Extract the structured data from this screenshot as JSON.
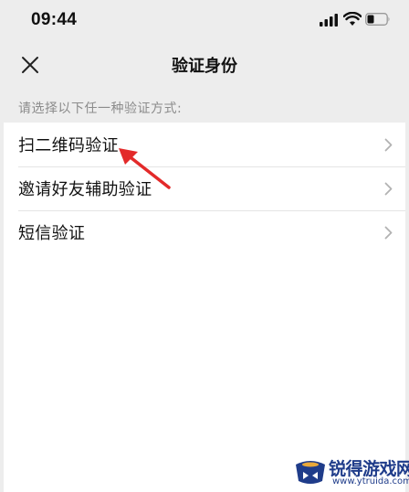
{
  "status_bar": {
    "time": "09:44",
    "icons": [
      "signal-icon",
      "wifi-icon",
      "battery-icon"
    ]
  },
  "nav": {
    "title": "验证身份",
    "close_icon": "close-icon"
  },
  "hint": "请选择以下任一种验证方式:",
  "options": [
    {
      "label": "扫二维码验证",
      "icon": "chevron-right-icon"
    },
    {
      "label": "邀请好友辅助验证",
      "icon": "chevron-right-icon"
    },
    {
      "label": "短信验证",
      "icon": "chevron-right-icon"
    }
  ],
  "annotation": {
    "color": "#e32a2a",
    "icon": "red-arrow-icon"
  },
  "watermark": {
    "text": "锐得游戏网",
    "url": "www.ytruida.com",
    "color": "#1f3c8a"
  },
  "colors": {
    "background": "#ededed",
    "list_background": "#ffffff",
    "hint_text": "#8c8c8c"
  }
}
